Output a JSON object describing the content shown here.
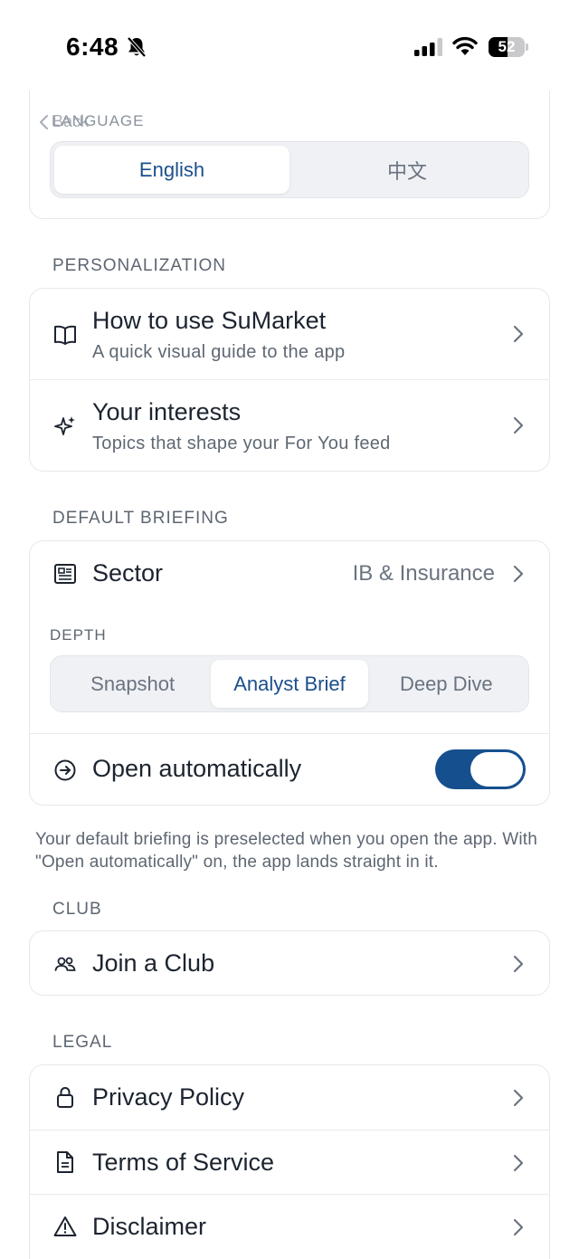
{
  "status_bar": {
    "time": "6:48",
    "battery": "52",
    "battery_level": 0.52,
    "icons": [
      "bell-slash-icon",
      "cellular-signal-icon",
      "wifi-icon",
      "battery-icon"
    ]
  },
  "nav": {
    "back_label": "Back"
  },
  "language": {
    "label": "LANGUAGE",
    "options": [
      "English",
      "中文"
    ],
    "selected": "English"
  },
  "personalization": {
    "label": "PERSONALIZATION",
    "items": [
      {
        "title": "How to use SuMarket",
        "subtitle": "A quick visual guide to the app",
        "icon": "book-icon"
      },
      {
        "title": "Your interests",
        "subtitle": "Topics that shape your For You feed",
        "icon": "sparkles-icon"
      }
    ]
  },
  "default_briefing": {
    "label": "DEFAULT BRIEFING",
    "sector": {
      "title": "Sector",
      "value": "IB & Insurance",
      "icon": "newspaper-icon"
    },
    "depth": {
      "label": "DEPTH",
      "options": [
        "Snapshot",
        "Analyst Brief",
        "Deep Dive"
      ],
      "selected": "Analyst Brief"
    },
    "open_automatically": {
      "title": "Open automatically",
      "enabled": true,
      "icon": "arrow-circle-icon"
    },
    "note": "Your default briefing is preselected when you open the app. With \"Open automatically\" on, the app lands straight in it."
  },
  "club": {
    "label": "CLUB",
    "items": [
      {
        "title": "Join a Club",
        "icon": "people-icon"
      }
    ]
  },
  "legal": {
    "label": "LEGAL",
    "items": [
      {
        "title": "Privacy Policy",
        "icon": "lock-icon"
      },
      {
        "title": "Terms of Service",
        "icon": "document-icon"
      },
      {
        "title": "Disclaimer",
        "icon": "warning-icon"
      }
    ]
  },
  "colors": {
    "accent": "#154f8e",
    "selected_text": "#1b4f8c",
    "segment_bg": "#eff1f4",
    "card_border": "#e6e8ec",
    "muted_text": "#5d6672"
  }
}
